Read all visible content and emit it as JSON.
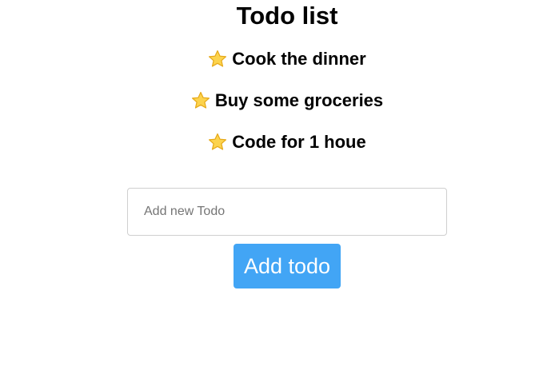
{
  "app": {
    "title": "Todo list"
  },
  "todos": [
    {
      "icon": "star-icon",
      "text": "Cook the dinner"
    },
    {
      "icon": "star-icon",
      "text": "Buy some groceries"
    },
    {
      "icon": "star-icon",
      "text": "Code for 1 houe"
    }
  ],
  "form": {
    "input_value": "",
    "input_placeholder": "Add new Todo",
    "button_label": "Add todo"
  },
  "colors": {
    "button_background": "#42a5f5",
    "button_text": "#ffffff",
    "star_fill": "#fcd34d",
    "star_stroke": "#e6a817"
  }
}
